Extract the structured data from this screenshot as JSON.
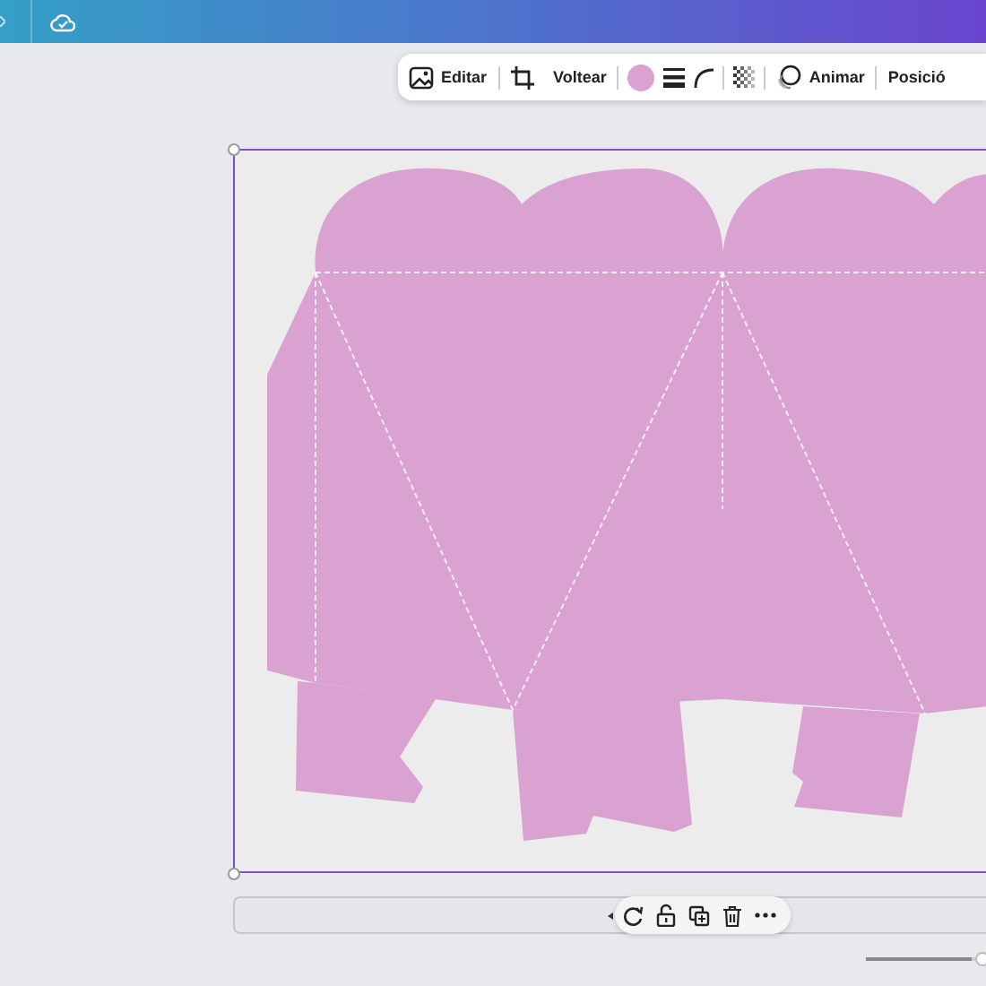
{
  "toolbar": {
    "items": [
      {
        "kind": "edit",
        "label": "Editar"
      },
      {
        "kind": "divider"
      },
      {
        "kind": "flip",
        "label": "Voltear"
      },
      {
        "kind": "divider"
      },
      {
        "kind": "color",
        "color": "#d9a2d0"
      },
      {
        "kind": "border-style"
      },
      {
        "kind": "corner"
      },
      {
        "kind": "divider"
      },
      {
        "kind": "transparency"
      },
      {
        "kind": "divider"
      },
      {
        "kind": "animate",
        "label": "Animar"
      },
      {
        "kind": "divider"
      },
      {
        "kind": "position",
        "label": "Posició"
      }
    ]
  },
  "canvas": {
    "selected": true
  },
  "zoom_slider": {
    "level": 0.97
  }
}
